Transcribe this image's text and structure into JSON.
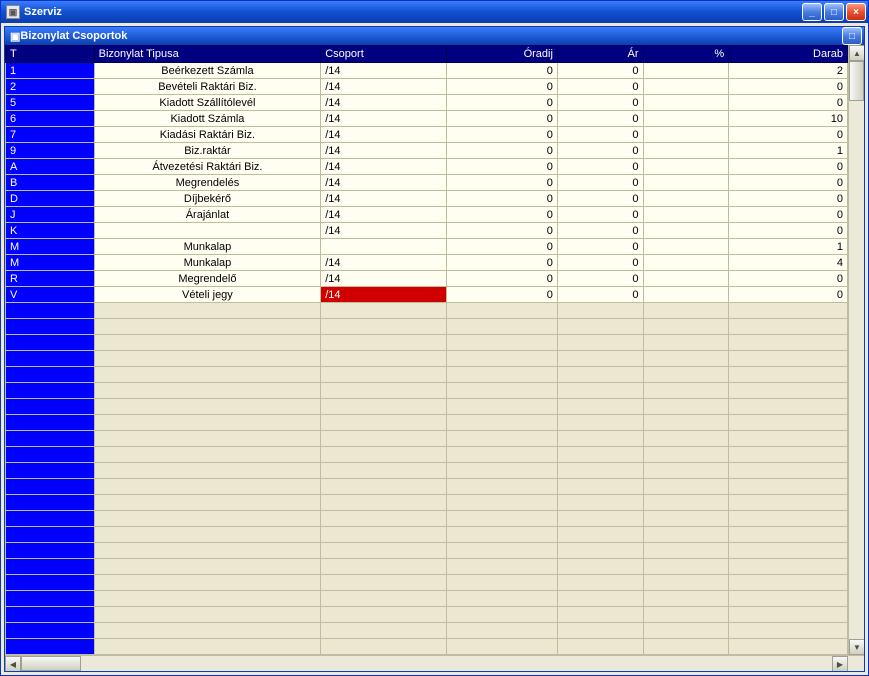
{
  "outerWindow": {
    "title": "Szerviz",
    "minimize": "_",
    "maximize": "□",
    "close": "×"
  },
  "innerWindow": {
    "title": "Bizonylat Csoportok",
    "minimize": "_",
    "maximize": "□",
    "close": "×"
  },
  "columns": {
    "t": "T",
    "tipus": "Bizonylat Tipusa",
    "csoport": "Csoport",
    "oradij": "Óradij",
    "ar": "Ár",
    "szazalek": "%",
    "darab": "Darab"
  },
  "rows": [
    {
      "t": "1",
      "tipus": "Beérkezett Számla",
      "csoport": "/14",
      "oradij": "0",
      "ar": "0",
      "szazalek": "",
      "darab": "2",
      "hl": false
    },
    {
      "t": "2",
      "tipus": "Bevételi Raktári Biz.",
      "csoport": "/14",
      "oradij": "0",
      "ar": "0",
      "szazalek": "",
      "darab": "0",
      "hl": false
    },
    {
      "t": "5",
      "tipus": "Kiadott Szállítólevél",
      "csoport": "/14",
      "oradij": "0",
      "ar": "0",
      "szazalek": "",
      "darab": "0",
      "hl": false
    },
    {
      "t": "6",
      "tipus": "Kiadott Számla",
      "csoport": "/14",
      "oradij": "0",
      "ar": "0",
      "szazalek": "",
      "darab": "10",
      "hl": false
    },
    {
      "t": "7",
      "tipus": "Kiadási Raktári Biz.",
      "csoport": "/14",
      "oradij": "0",
      "ar": "0",
      "szazalek": "",
      "darab": "0",
      "hl": false
    },
    {
      "t": "9",
      "tipus": "Biz.raktár",
      "csoport": "/14",
      "oradij": "0",
      "ar": "0",
      "szazalek": "",
      "darab": "1",
      "hl": false
    },
    {
      "t": "A",
      "tipus": "Átvezetési Raktári Biz.",
      "csoport": "/14",
      "oradij": "0",
      "ar": "0",
      "szazalek": "",
      "darab": "0",
      "hl": false
    },
    {
      "t": "B",
      "tipus": "Megrendelés",
      "csoport": "/14",
      "oradij": "0",
      "ar": "0",
      "szazalek": "",
      "darab": "0",
      "hl": false
    },
    {
      "t": "D",
      "tipus": "Díjbekérő",
      "csoport": "/14",
      "oradij": "0",
      "ar": "0",
      "szazalek": "",
      "darab": "0",
      "hl": false
    },
    {
      "t": "J",
      "tipus": "Árajánlat",
      "csoport": "/14",
      "oradij": "0",
      "ar": "0",
      "szazalek": "",
      "darab": "0",
      "hl": false
    },
    {
      "t": "K",
      "tipus": "",
      "csoport": "/14",
      "oradij": "0",
      "ar": "0",
      "szazalek": "",
      "darab": "0",
      "hl": false
    },
    {
      "t": "M",
      "tipus": "Munkalap",
      "csoport": "",
      "oradij": "0",
      "ar": "0",
      "szazalek": "",
      "darab": "1",
      "hl": false
    },
    {
      "t": "M",
      "tipus": "Munkalap",
      "csoport": "/14",
      "oradij": "0",
      "ar": "0",
      "szazalek": "",
      "darab": "4",
      "hl": false
    },
    {
      "t": "R",
      "tipus": "Megrendelő",
      "csoport": "/14",
      "oradij": "0",
      "ar": "0",
      "szazalek": "",
      "darab": "0",
      "hl": false
    },
    {
      "t": "V",
      "tipus": "Vételi jegy",
      "csoport": "/14",
      "oradij": "0",
      "ar": "0",
      "szazalek": "",
      "darab": "0",
      "hl": true
    }
  ],
  "emptyRowCount": 22
}
